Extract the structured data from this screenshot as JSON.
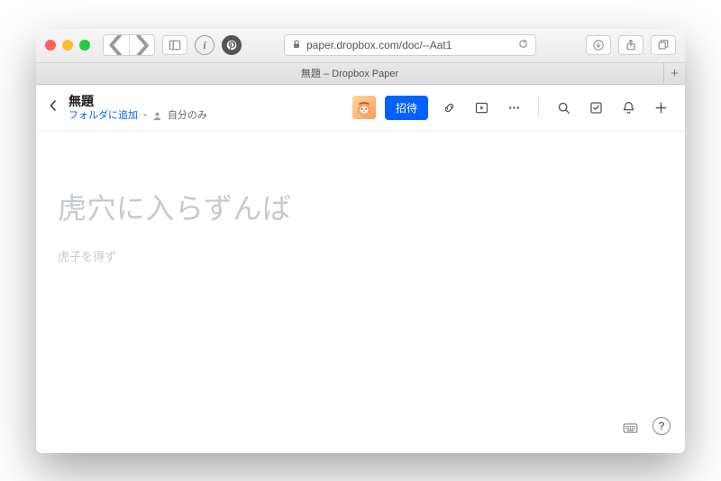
{
  "browser": {
    "url": "paper.dropbox.com/doc/--Aat1",
    "tab_title": "無題 – Dropbox Paper"
  },
  "header": {
    "title": "無題",
    "folder_link": "フォルダに追加",
    "sharing_label": "自分のみ",
    "invite_label": "招待"
  },
  "document": {
    "title_placeholder": "虎穴に入らずんば",
    "body_placeholder": "虎子を得ず"
  }
}
